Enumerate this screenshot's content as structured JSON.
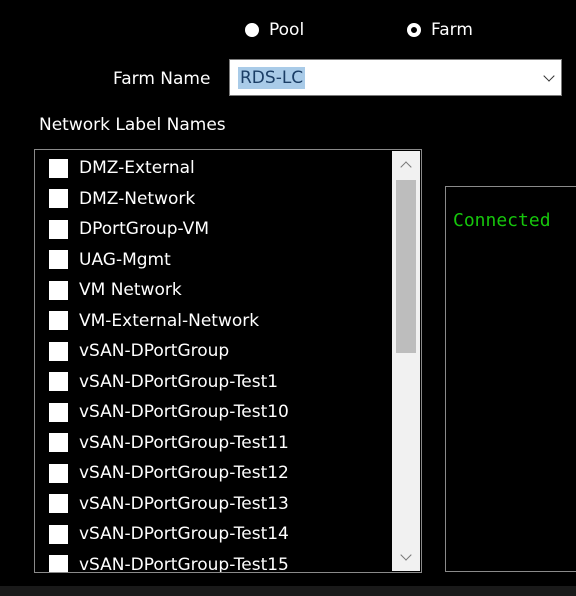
{
  "mode": {
    "options": [
      {
        "label": "Pool",
        "checked": false
      },
      {
        "label": "Farm",
        "checked": true
      }
    ]
  },
  "farm": {
    "label": "Farm Name",
    "value": "RDS-LC"
  },
  "network": {
    "title": "Network Label Names",
    "items": [
      {
        "label": "DMZ-External",
        "checked": false
      },
      {
        "label": "DMZ-Network",
        "checked": false
      },
      {
        "label": "DPortGroup-VM",
        "checked": false
      },
      {
        "label": "UAG-Mgmt",
        "checked": false
      },
      {
        "label": "VM Network",
        "checked": false
      },
      {
        "label": "VM-External-Network",
        "checked": false
      },
      {
        "label": "vSAN-DPortGroup",
        "checked": false
      },
      {
        "label": "vSAN-DPortGroup-Test1",
        "checked": false
      },
      {
        "label": "vSAN-DPortGroup-Test10",
        "checked": false
      },
      {
        "label": "vSAN-DPortGroup-Test11",
        "checked": false
      },
      {
        "label": "vSAN-DPortGroup-Test12",
        "checked": false
      },
      {
        "label": "vSAN-DPortGroup-Test13",
        "checked": false
      },
      {
        "label": "vSAN-DPortGroup-Test14",
        "checked": false
      },
      {
        "label": "vSAN-DPortGroup-Test15",
        "checked": false
      }
    ]
  },
  "console": {
    "status": "Connected"
  },
  "colors": {
    "background": "#000000",
    "selection": "#a9cbe8",
    "console_text": "#16c60c"
  }
}
